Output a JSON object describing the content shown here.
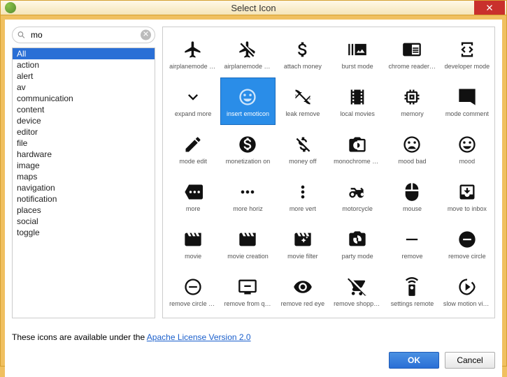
{
  "window": {
    "title": "Select Icon"
  },
  "search": {
    "value": "mo"
  },
  "categories": [
    "All",
    "action",
    "alert",
    "av",
    "communication",
    "content",
    "device",
    "editor",
    "file",
    "hardware",
    "image",
    "maps",
    "navigation",
    "notification",
    "places",
    "social",
    "toggle"
  ],
  "selected_category_index": 0,
  "icons": [
    {
      "id": "airplanemode-active",
      "label": "airplanemode acti"
    },
    {
      "id": "airplanemode-inactive",
      "label": "airplanemode ina"
    },
    {
      "id": "attach-money",
      "label": "attach money"
    },
    {
      "id": "burst-mode",
      "label": "burst mode"
    },
    {
      "id": "chrome-reader-mode",
      "label": "chrome reader mo"
    },
    {
      "id": "developer-mode",
      "label": "developer mode"
    },
    {
      "id": "expand-more",
      "label": "expand more"
    },
    {
      "id": "insert-emoticon",
      "label": "insert emoticon"
    },
    {
      "id": "leak-remove",
      "label": "leak remove"
    },
    {
      "id": "local-movies",
      "label": "local movies"
    },
    {
      "id": "memory",
      "label": "memory"
    },
    {
      "id": "mode-comment",
      "label": "mode comment"
    },
    {
      "id": "mode-edit",
      "label": "mode edit"
    },
    {
      "id": "monetization-on",
      "label": "monetization on"
    },
    {
      "id": "money-off",
      "label": "money off"
    },
    {
      "id": "monochrome-photos",
      "label": "monochrome pho"
    },
    {
      "id": "mood-bad",
      "label": "mood bad"
    },
    {
      "id": "mood",
      "label": "mood"
    },
    {
      "id": "more",
      "label": "more"
    },
    {
      "id": "more-horiz",
      "label": "more horiz"
    },
    {
      "id": "more-vert",
      "label": "more vert"
    },
    {
      "id": "motorcycle",
      "label": "motorcycle"
    },
    {
      "id": "mouse",
      "label": "mouse"
    },
    {
      "id": "move-to-inbox",
      "label": "move to inbox"
    },
    {
      "id": "movie",
      "label": "movie"
    },
    {
      "id": "movie-creation",
      "label": "movie creation"
    },
    {
      "id": "movie-filter",
      "label": "movie filter"
    },
    {
      "id": "party-mode",
      "label": "party mode"
    },
    {
      "id": "remove",
      "label": "remove"
    },
    {
      "id": "remove-circle",
      "label": "remove circle"
    },
    {
      "id": "remove-circle-outline",
      "label": "remove circle outli"
    },
    {
      "id": "remove-from-queue",
      "label": "remove from que"
    },
    {
      "id": "remove-red-eye",
      "label": "remove red eye"
    },
    {
      "id": "remove-shopping-cart",
      "label": "remove shopping"
    },
    {
      "id": "settings-remote",
      "label": "settings remote"
    },
    {
      "id": "slow-motion-video",
      "label": "slow motion video"
    }
  ],
  "selected_icon_index": 7,
  "footer": {
    "text_prefix": "These icons are available under the ",
    "link_text": "Apache License Version 2.0"
  },
  "buttons": {
    "ok": "OK",
    "cancel": "Cancel"
  }
}
